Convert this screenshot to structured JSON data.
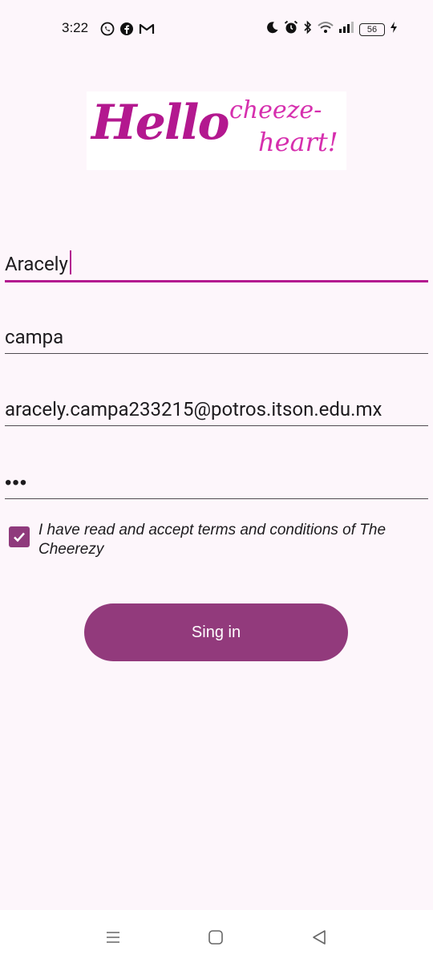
{
  "status_bar": {
    "time": "3:22",
    "left_icons": [
      "whatsapp-icon",
      "facebook-icon",
      "gmail-icon"
    ],
    "right_icons": [
      "moon-icon",
      "alarm-icon",
      "bluetooth-icon",
      "wifi-icon",
      "signal-icon",
      "battery-icon",
      "charging-icon"
    ],
    "battery_level": "56"
  },
  "logo": {
    "main_text": "Hello",
    "sub_text_1": "cheeze-",
    "sub_text_2": "heart!"
  },
  "form": {
    "first_name": "Aracely",
    "last_name": "campa",
    "email": "aracely.campa233215@potros.itson.edu.mx",
    "password_masked": "•••",
    "terms_checked": true,
    "terms_label": "I have read and accept terms and conditions of The Cheerezy",
    "submit_label": "Sing in"
  },
  "colors": {
    "accent": "#b3188f",
    "button": "#923a7c",
    "checkbox": "#8f3a7c",
    "background": "#fdf6fb"
  },
  "nav_bar": {
    "buttons": [
      "recents-icon",
      "home-icon",
      "back-icon"
    ]
  }
}
